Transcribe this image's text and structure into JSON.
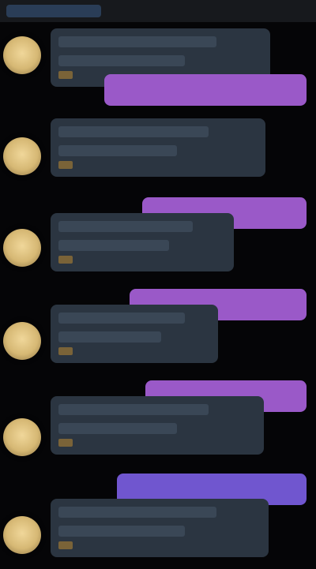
{
  "header": {
    "title": ""
  },
  "messages": [
    {
      "incoming": {
        "line1": "",
        "line2": "",
        "time": ""
      },
      "outgoing": {
        "text": ""
      }
    },
    {
      "incoming": {
        "line1": "",
        "line2": "",
        "time": ""
      },
      "outgoing": {
        "text": ""
      }
    },
    {
      "incoming": {
        "line1": "",
        "line2": "",
        "time": ""
      },
      "outgoing": {
        "text": ""
      }
    },
    {
      "incoming": {
        "line1": "",
        "line2": "",
        "time": ""
      },
      "outgoing": {
        "text": ""
      }
    },
    {
      "incoming": {
        "line1": "",
        "line2": "",
        "time": ""
      },
      "outgoing": {
        "text": ""
      }
    },
    {
      "incoming": {
        "line1": "",
        "line2": "",
        "time": ""
      }
    }
  ],
  "colors": {
    "background": "#050507",
    "header": "#17191d",
    "incoming_bubble": "#2b3541",
    "outgoing_bubble": "#9a59c8",
    "outgoing_bubble_alt": "#7056cf",
    "avatar": "#e3c886"
  },
  "icons": {
    "avatar": "user-avatar"
  }
}
